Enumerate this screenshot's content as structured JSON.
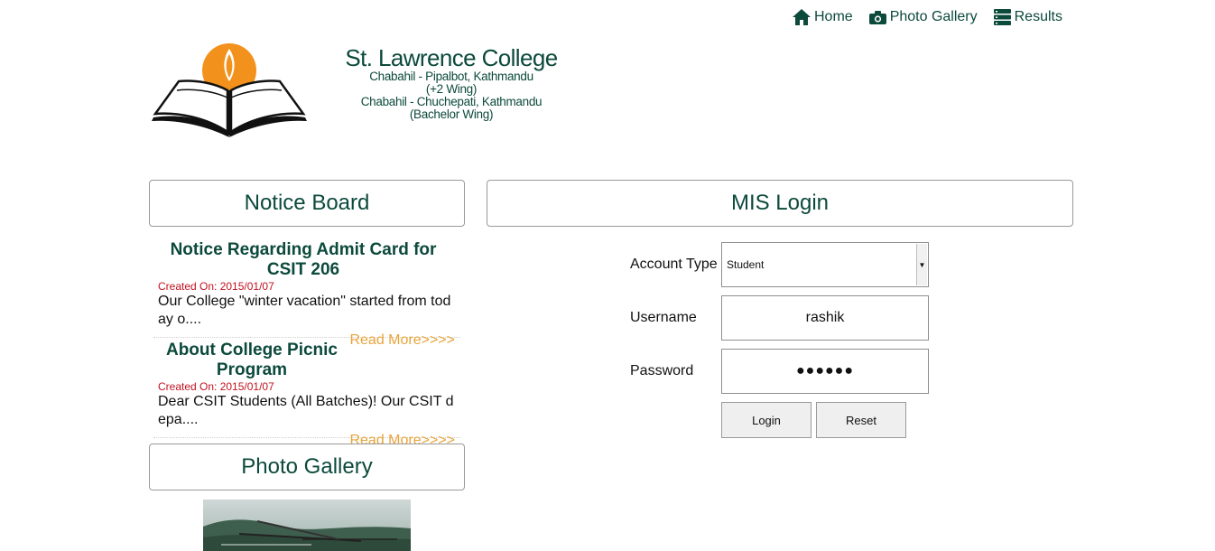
{
  "nav": {
    "home": "Home",
    "gallery": "Photo Gallery",
    "results": "Results"
  },
  "header": {
    "name": "St. Lawrence College",
    "addr1": "Chabahil - Pipalbot, Kathmandu",
    "addr2": "(+2 Wing)",
    "addr3": "Chabahil - Chuchepati, Kathmandu",
    "addr4": "(Bachelor Wing)"
  },
  "notice_board": {
    "title": "Notice Board",
    "items": [
      {
        "title": "Notice Regarding Admit Card for CSIT 206",
        "date": "Created On: 2015/01/07",
        "body": "Our College \"winter vacation\" started from today o....",
        "more": "Read More>>>>"
      },
      {
        "title": "About College Picnic Program",
        "date": "Created On: 2015/01/07",
        "body": "Dear CSIT Students (All Batches)! Our CSIT depa....",
        "more": "Read More>>>>"
      }
    ]
  },
  "gallery": {
    "title": "Photo Gallery"
  },
  "login": {
    "title": "MIS Login",
    "account_label": "Account Type",
    "account_value": "Student",
    "username_label": "Username",
    "username_value": "rashik",
    "password_label": "Password",
    "password_mask": "●●●●●●",
    "login_btn": "Login",
    "reset_btn": "Reset"
  },
  "colors": {
    "brand_green": "#0c4a3b",
    "date_red": "#c1121f",
    "read_more": "#e8a43a",
    "logo_orange": "#f2921c"
  }
}
